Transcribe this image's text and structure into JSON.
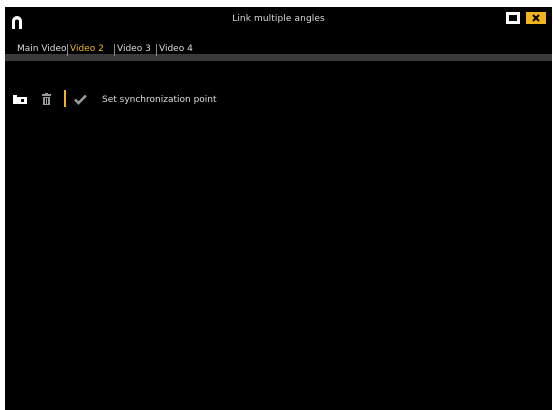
{
  "window": {
    "title": "Link multiple angles"
  },
  "titlebar": {
    "logo_icon": "horseshoe-logo-icon",
    "maximize_icon": "maximize-icon",
    "close_icon": "close-icon",
    "accent_color": "#f0b41e"
  },
  "tabs": [
    {
      "label": "Main Video",
      "active": false
    },
    {
      "label": "Video 2",
      "active": true
    },
    {
      "label": "Video 3",
      "active": false
    },
    {
      "label": "Video 4",
      "active": false
    }
  ],
  "toolbar": {
    "camera_icon": "camera-icon",
    "trash_icon": "trash-icon",
    "check_icon": "checkmark-icon",
    "sync_label": "Set synchronization point"
  }
}
